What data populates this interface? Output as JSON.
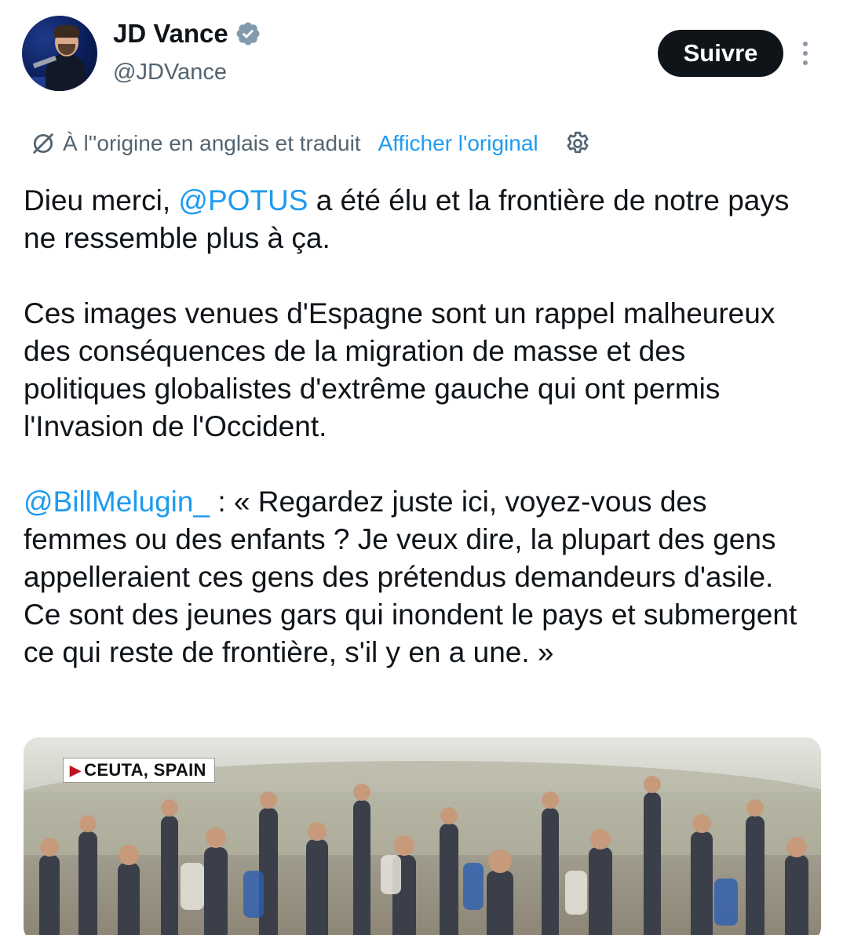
{
  "author": {
    "name": "JD Vance",
    "handle": "@JDVance",
    "verified": true,
    "avatar_icon": "profile-photo"
  },
  "actions": {
    "follow_label": "Suivre",
    "more_icon": "more-vertical-icon"
  },
  "translation": {
    "icon": "translate-icon",
    "notice": "À l''origine en anglais et traduit",
    "show_original_label": "Afficher l'original",
    "settings_icon": "gear-icon"
  },
  "tweet": {
    "p1_before": "Dieu merci, ",
    "p1_mention": "@POTUS",
    "p1_after": " a été élu et la frontière de notre pays ne ressemble plus à ça.",
    "p2": "Ces images venues d'Espagne sont un rappel malheureux des conséquences de la migration de masse et des politiques globalistes d'extrême gauche qui ont permis l'Invasion de l'Occident.",
    "p3_mention": "@BillMelugin_",
    "p3_after": " : « Regardez juste ici, voyez-vous des femmes ou des enfants ? Je veux dire, la plupart des gens appelleraient ces gens des prétendus demandeurs d'asile. Ce sont des jeunes gars qui inondent le pays et submergent ce qui reste de frontière, s'il y en a une. »"
  },
  "media": {
    "label": "CEUTA, SPAIN"
  },
  "colors": {
    "link": "#1d9bf0",
    "text": "#0f1419",
    "secondary": "#536471",
    "verified_badge": "#829aab"
  }
}
